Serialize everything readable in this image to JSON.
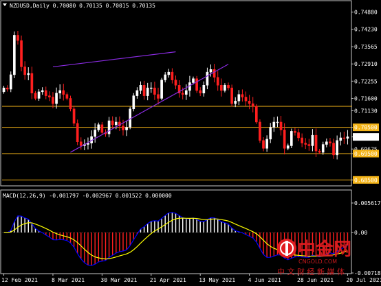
{
  "colors": {
    "background": "#000000",
    "frame": "#c8c8c8",
    "bull_candle": "#ffffff",
    "bear_candle": "#ff1f1f",
    "level_line": "#f3b317",
    "level_label_bg": "#f3b317",
    "current_price_bg": "#ffffff",
    "channel_line": "#8a2be2",
    "macd_histogram_pos": "#ffffff",
    "macd_histogram_neg": "#ff1f1f",
    "macd_line": "#0000ff",
    "macd_signal": "#ffff00",
    "watermark_red": "#e21d21"
  },
  "header": {
    "title": "NZDUSD,Daily  0.70080 0.70135 0.70015 0.70135"
  },
  "macd_header": {
    "title": "MACD(12,26,9) -0.001797 -0.002967 0.001522 0.000000"
  },
  "watermark": {
    "brand_cn": "中金网",
    "brand_en": "CNGOLD.COM",
    "tagline": "中 文 财 经 新 媒 体"
  },
  "chart_data": [
    {
      "type": "candlestick",
      "title": "NZDUSD,Daily",
      "symbol": "NZDUSD",
      "timeframe": "Daily",
      "ohlc_last": {
        "open": 0.7008,
        "high": 0.70135,
        "low": 0.70015,
        "close": 0.70135
      },
      "ylim": [
        0.683,
        0.7495
      ],
      "y_ticks": [
        "0.74880",
        "0.74230",
        "0.73565",
        "0.72910",
        "0.72255",
        "0.71600",
        "0.71130",
        "0.70500",
        "0.70135",
        "0.69675",
        "0.69500",
        "0.68500"
      ],
      "x_ticks": [
        "12 Feb 2021",
        "8 Mar 2021",
        "30 Mar 2021",
        "21 Apr 2021",
        "13 May 2021",
        "4 Jun 2021",
        "28 Jun 2021",
        "20 Jul 2021"
      ],
      "horizontal_levels": [
        "0.71300",
        "0.70500",
        "0.69500",
        "0.68500"
      ],
      "current_price": "0.70135",
      "closes": [
        0.72,
        0.7195,
        0.725,
        0.74,
        0.738,
        0.728,
        0.725,
        0.7255,
        0.718,
        0.716,
        0.7185,
        0.719,
        0.717,
        0.7165,
        0.714,
        0.718,
        0.719,
        0.7175,
        0.716,
        0.712,
        0.7065,
        0.6995,
        0.698,
        0.6985,
        0.699,
        0.7015,
        0.704,
        0.706,
        0.703,
        0.7025,
        0.7075,
        0.706,
        0.707,
        0.7055,
        0.704,
        0.705,
        0.712,
        0.717,
        0.719,
        0.721,
        0.717,
        0.72,
        0.72,
        0.7175,
        0.716,
        0.723,
        0.725,
        0.726,
        0.723,
        0.721,
        0.718,
        0.7175,
        0.719,
        0.722,
        0.7235,
        0.719,
        0.718,
        0.721,
        0.726,
        0.727,
        0.724,
        0.721,
        0.719,
        0.721,
        0.72,
        0.714,
        0.715,
        0.7175,
        0.7165,
        0.715,
        0.714,
        0.713,
        0.707,
        0.7,
        0.697,
        0.7005,
        0.705,
        0.707,
        0.707,
        0.704,
        0.697,
        0.698,
        0.7035,
        0.703,
        0.701,
        0.699,
        0.6985,
        0.698,
        0.702,
        0.696,
        0.6955,
        0.6985,
        0.6995,
        0.699,
        0.6945,
        0.7,
        0.701,
        0.7008,
        0.7014
      ],
      "channel_lines": [
        {
          "label": "upper",
          "points": [
            [
              14,
              0.728
            ],
            [
              49,
              0.7337
            ]
          ]
        },
        {
          "label": "lower",
          "points": [
            [
              19,
              0.6955
            ],
            [
              64,
              0.729
            ]
          ]
        }
      ]
    },
    {
      "type": "macd",
      "title": "MACD(12,26,9)",
      "params": [
        12,
        26,
        9
      ],
      "values_last": {
        "main": -0.001797,
        "signal": -0.002967,
        "histogram": 0.001522,
        "zero": 0.0
      },
      "ylim": [
        -0.00718,
        0.00561
      ],
      "y_ticks": [
        "0.005617",
        "0.00",
        "-0.00718"
      ]
    }
  ]
}
